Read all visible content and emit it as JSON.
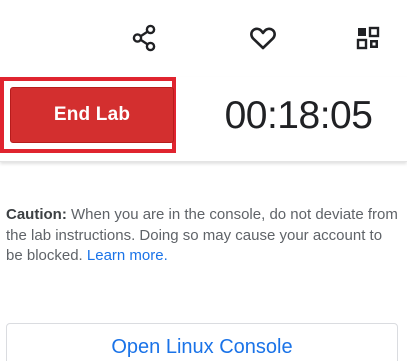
{
  "toolbar": {
    "share_icon": "share-icon",
    "favorite_icon": "heart-icon",
    "qr_icon": "qr-code-icon"
  },
  "lab": {
    "end_label": "End Lab",
    "timer": "00:18:05",
    "highlight_color": "#e0242f",
    "end_button_color": "#d32f2f"
  },
  "caution": {
    "label": "Caution:",
    "text": " When you are in the console, do not deviate from the lab instructions. Doing so may cause your account to be blocked. ",
    "link": "Learn more."
  },
  "console": {
    "open_label": "Open Linux Console",
    "link_color": "#1a73e8"
  }
}
